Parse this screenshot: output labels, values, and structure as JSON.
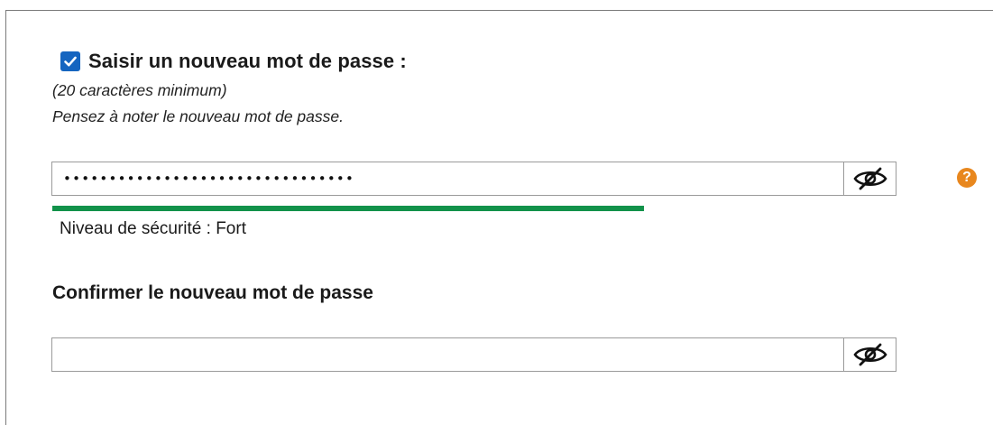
{
  "new_password": {
    "checkbox_checked": true,
    "label": "Saisir un nouveau mot de passe :",
    "hint_min_length": "(20 caractères minimum)",
    "hint_note": "Pensez à noter le nouveau mot de passe.",
    "masked_value": "••••••••••••••••••••••••••••••••",
    "toggle_icon": "eye-slash-icon",
    "help_icon": "question-circle-icon",
    "help_color": "#e8871e"
  },
  "strength": {
    "level_fraction": 0.7,
    "color": "#12924a",
    "text": "Niveau de sécurité : Fort"
  },
  "confirm_password": {
    "label": "Confirmer le nouveau mot de passe",
    "value": "",
    "toggle_icon": "eye-slash-icon"
  }
}
